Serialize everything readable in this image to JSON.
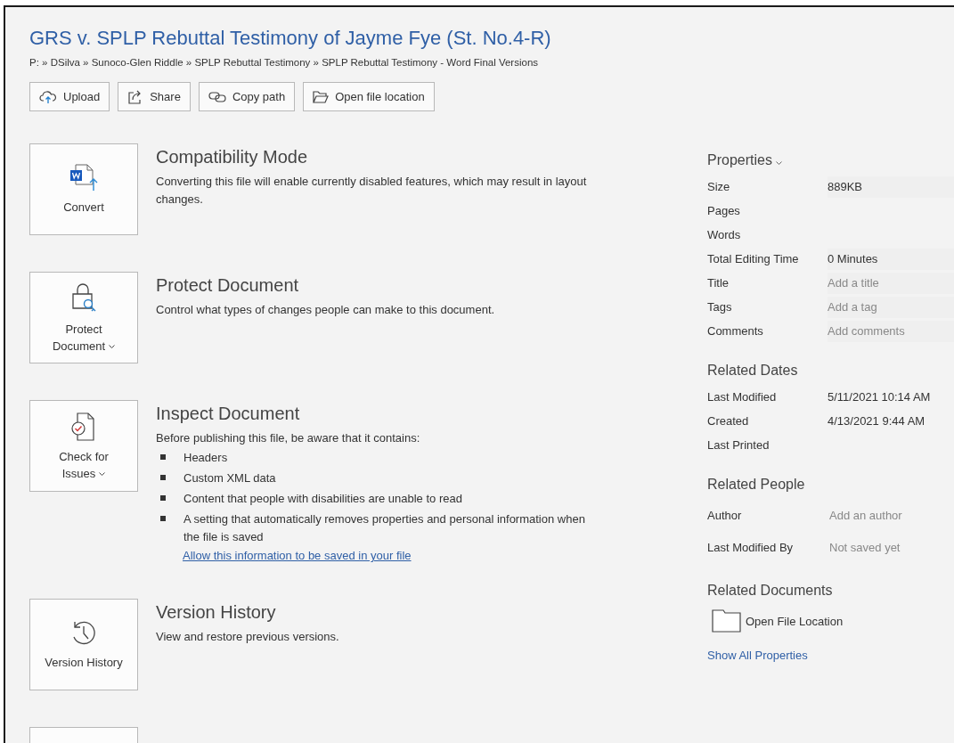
{
  "title": "GRS v. SPLP Rebuttal Testimony of Jayme Fye (St. No.4-R)",
  "breadcrumb": "P: » DSilva » Sunoco-Glen Riddle » SPLP Rebuttal Testimony » SPLP Rebuttal Testimony - Word Final Versions",
  "actions": [
    {
      "kind": "upload",
      "label": "Upload"
    },
    {
      "kind": "share",
      "label": "Share"
    },
    {
      "kind": "link",
      "label": "Copy path"
    },
    {
      "kind": "folder",
      "label": "Open file location"
    }
  ],
  "sections": [
    {
      "kind": "convert",
      "button": "Convert",
      "has_menu": false,
      "title": "Compatibility Mode",
      "description": "Converting this file will enable currently disabled features, which may result in layout changes."
    },
    {
      "kind": "protect",
      "button": "Protect Document",
      "has_menu": true,
      "title": "Protect Document",
      "description": "Control what types of changes people can make to this document."
    },
    {
      "kind": "inspect",
      "button": "Check for Issues",
      "has_menu": true,
      "title": "Inspect Document",
      "description": "Before publishing this file, be aware that it contains:",
      "bullets": [
        "Headers",
        "Custom XML data",
        "Content that people with disabilities are unable to read",
        "A setting that automatically removes properties and personal information when the file is saved"
      ],
      "link": "Allow this information to be saved in your file"
    },
    {
      "kind": "history",
      "button": "Version History",
      "has_menu": false,
      "title": "Version History",
      "description": "View and restore previous versions."
    },
    {
      "kind": "partial"
    }
  ],
  "properties": {
    "heading": "Properties",
    "rows": [
      {
        "label": "Size",
        "value": "889KB"
      },
      {
        "label": "Pages"
      },
      {
        "label": "Words"
      },
      {
        "label": "Total Editing Time",
        "value": "0 Minutes"
      },
      {
        "label": "Title",
        "placeholder": "Add a title"
      },
      {
        "label": "Tags",
        "placeholder": "Add a tag"
      },
      {
        "label": "Comments",
        "placeholder": "Add comments"
      }
    ]
  },
  "related_dates": {
    "heading": "Related Dates",
    "rows": [
      {
        "label": "Last Modified",
        "value": "5/11/2021 10:14 AM"
      },
      {
        "label": "Created",
        "value": "4/13/2021 9:44 AM"
      },
      {
        "label": "Last Printed"
      }
    ]
  },
  "related_people": {
    "heading": "Related People",
    "rows": [
      {
        "label": "Author",
        "placeholder": "Add an author"
      },
      {
        "label": "Last Modified By",
        "placeholder": "Not saved yet"
      }
    ]
  },
  "related_documents": {
    "heading": "Related Documents",
    "item": "Open File Location",
    "link": "Show All Properties"
  }
}
